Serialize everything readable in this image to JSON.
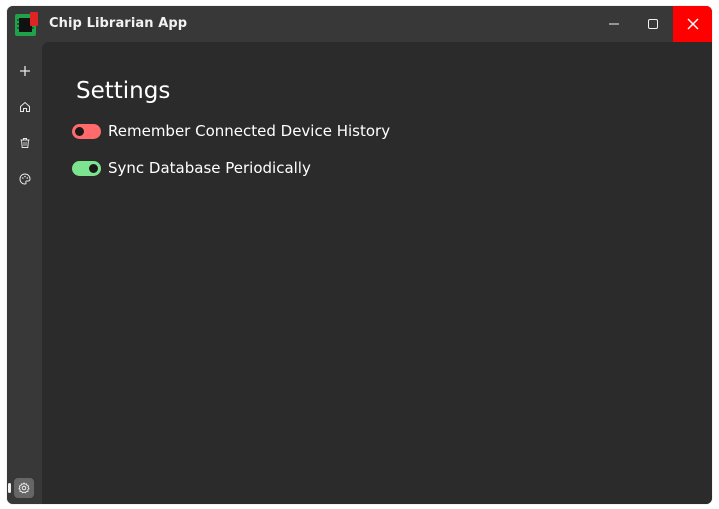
{
  "app": {
    "title": "Chip Librarian App",
    "icon": "chip-icon"
  },
  "window_controls": {
    "minimize": "minimize-icon",
    "maximize": "maximize-icon",
    "close": "close-icon",
    "close_color": "#ff0000"
  },
  "sidebar": {
    "items": [
      {
        "name": "add",
        "icon": "plus-icon"
      },
      {
        "name": "home",
        "icon": "home-icon"
      },
      {
        "name": "trash",
        "icon": "trash-icon"
      },
      {
        "name": "palette",
        "icon": "palette-icon"
      }
    ],
    "settings": {
      "icon": "gear-icon",
      "active": true
    }
  },
  "main": {
    "title": "Settings",
    "settings": [
      {
        "label": "Remember Connected Device History",
        "enabled": false,
        "color": "#ff6b6b"
      },
      {
        "label": "Sync Database Periodically",
        "enabled": true,
        "color": "#7ee38f"
      }
    ]
  },
  "colors": {
    "titlebar_bg": "#383838",
    "content_bg": "#2b2b2b",
    "text": "#ffffff"
  }
}
